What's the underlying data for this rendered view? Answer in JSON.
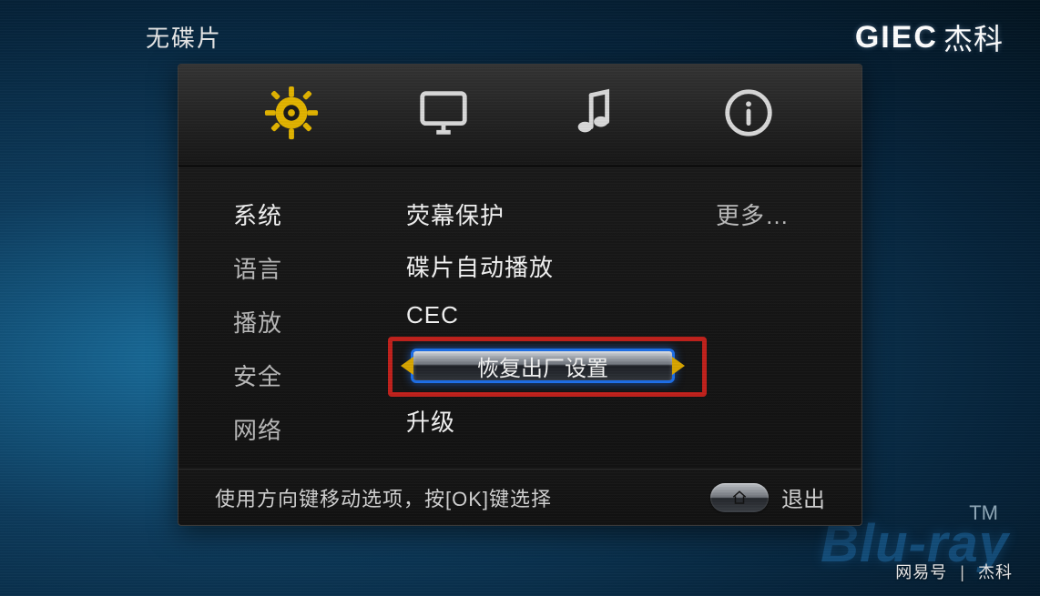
{
  "status": {
    "disc": "无碟片"
  },
  "brand": {
    "en": "GIEC",
    "cn": "杰科"
  },
  "tabs": {
    "items": [
      {
        "name": "settings",
        "active": true
      },
      {
        "name": "display",
        "active": false
      },
      {
        "name": "audio",
        "active": false
      },
      {
        "name": "info",
        "active": false
      }
    ]
  },
  "menu": {
    "categories": [
      {
        "label": "系统",
        "active": true
      },
      {
        "label": "语言",
        "active": false
      },
      {
        "label": "播放",
        "active": false
      },
      {
        "label": "安全",
        "active": false
      },
      {
        "label": "网络",
        "active": false
      }
    ],
    "options": [
      {
        "label": "荧幕保护"
      },
      {
        "label": "碟片自动播放"
      },
      {
        "label": "CEC"
      },
      {
        "label": "恢复出厂设置",
        "selected": true
      },
      {
        "label": "升级"
      }
    ],
    "more": "更多…"
  },
  "footer": {
    "hint": "使用方向键移动选项，按[OK]键选择",
    "exit": "退出"
  },
  "background": {
    "bluray": "Blu-ray",
    "tm": "TM"
  },
  "credit": {
    "source": "网易号",
    "sep": "|",
    "author": "杰科"
  }
}
